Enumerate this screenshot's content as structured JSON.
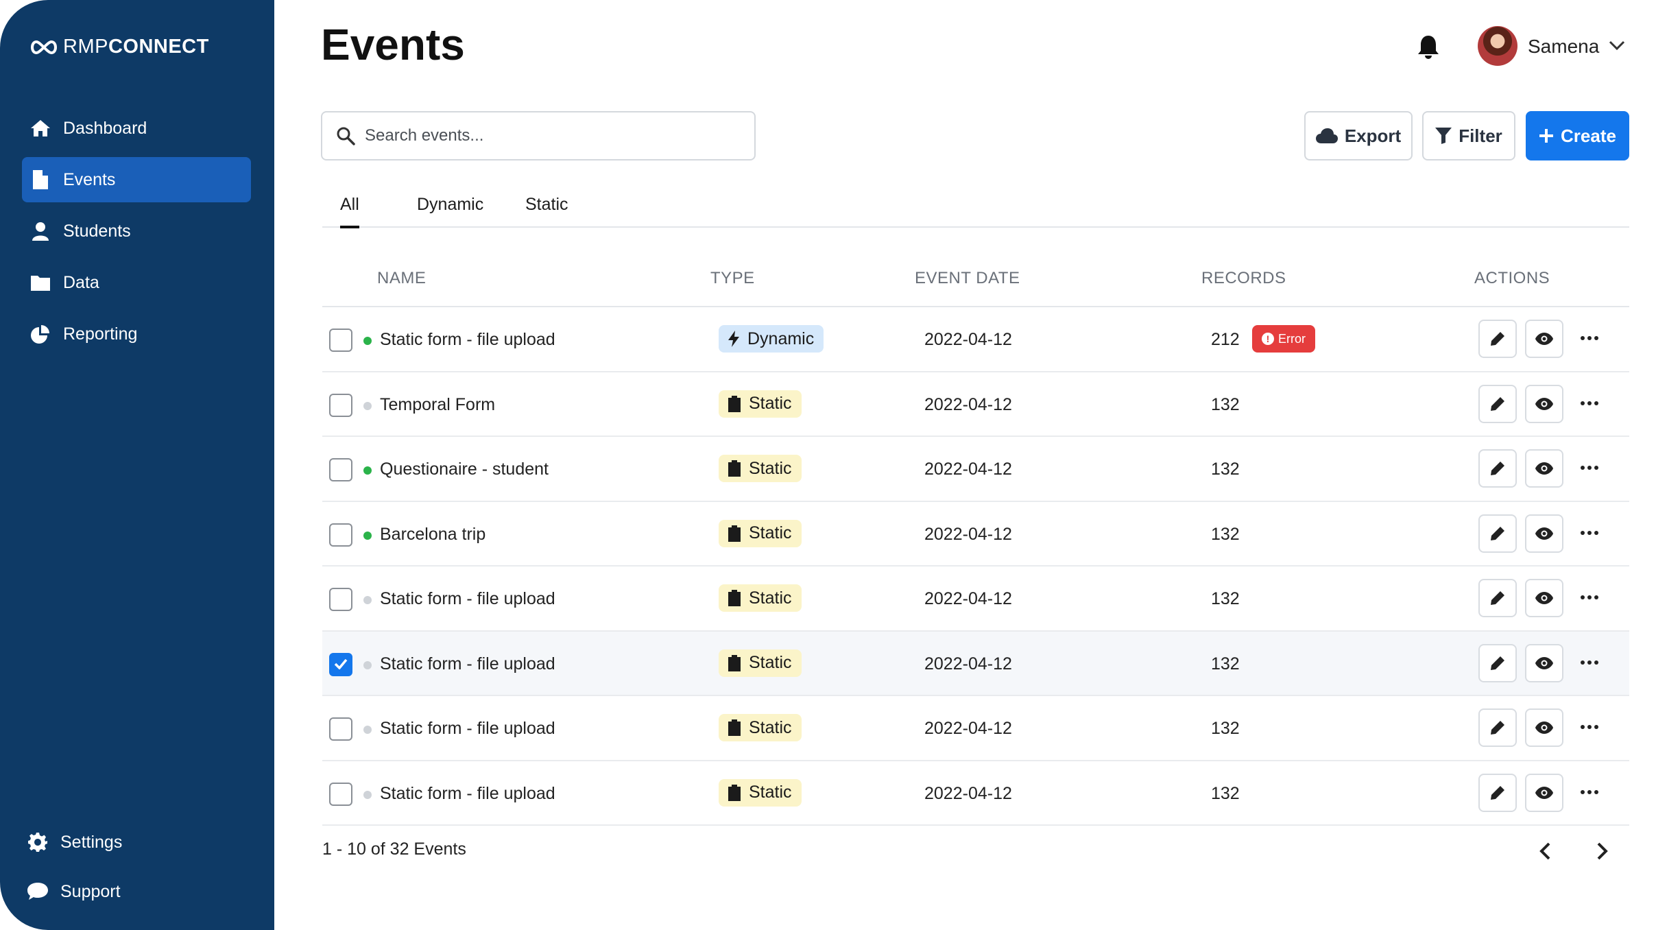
{
  "brand": {
    "prefix": "RMP",
    "suffix": "CONNECT"
  },
  "sidebar": {
    "items": [
      {
        "label": "Dashboard",
        "icon": "home-icon"
      },
      {
        "label": "Events",
        "icon": "file-icon",
        "active": true
      },
      {
        "label": "Students",
        "icon": "user-icon"
      },
      {
        "label": "Data",
        "icon": "folder-icon"
      },
      {
        "label": "Reporting",
        "icon": "pie-chart-icon"
      }
    ],
    "bottom": [
      {
        "label": "Settings",
        "icon": "gear-icon"
      },
      {
        "label": "Support",
        "icon": "chat-bubble-icon"
      }
    ]
  },
  "header": {
    "title": "Events",
    "user_name": "Samena"
  },
  "search": {
    "placeholder": "Search events..."
  },
  "toolbar": {
    "export_label": "Export",
    "filter_label": "Filter",
    "create_label": "Create"
  },
  "tabs": [
    {
      "label": "All",
      "active": true
    },
    {
      "label": "Dynamic"
    },
    {
      "label": "Static"
    }
  ],
  "table": {
    "columns": [
      "NAME",
      "TYPE",
      "EVENT DATE",
      "RECORDS",
      "ACTIONS"
    ],
    "rows": [
      {
        "name": "Static form - file upload",
        "status": "active",
        "type": "Dynamic",
        "date": "2022-04-12",
        "records": "212",
        "error": "Error",
        "checked": false
      },
      {
        "name": "Temporal Form",
        "status": "inactive",
        "type": "Static",
        "date": "2022-04-12",
        "records": "132",
        "checked": false
      },
      {
        "name": "Questionaire - student",
        "status": "active",
        "type": "Static",
        "date": "2022-04-12",
        "records": "132",
        "checked": false
      },
      {
        "name": "Barcelona trip",
        "status": "active",
        "type": "Static",
        "date": "2022-04-12",
        "records": "132",
        "checked": false
      },
      {
        "name": "Static form - file upload",
        "status": "inactive",
        "type": "Static",
        "date": "2022-04-12",
        "records": "132",
        "checked": false
      },
      {
        "name": "Static form - file upload",
        "status": "inactive",
        "type": "Static",
        "date": "2022-04-12",
        "records": "132",
        "checked": true
      },
      {
        "name": "Static form - file upload",
        "status": "inactive",
        "type": "Static",
        "date": "2022-04-12",
        "records": "132",
        "checked": false
      },
      {
        "name": "Static form - file upload",
        "status": "inactive",
        "type": "Static",
        "date": "2022-04-12",
        "records": "132",
        "checked": false
      }
    ]
  },
  "pagination": {
    "summary": "1 - 10 of 32 Events"
  },
  "colors": {
    "sidebar_bg": "#0e3a66",
    "sidebar_active": "#1a5fb8",
    "primary": "#1477ec",
    "status_active": "#2bb34a",
    "status_inactive": "#cfd3d8",
    "badge_static": "#fbf4c9",
    "badge_dynamic": "#d5e8fb",
    "error": "#e53d3d"
  }
}
